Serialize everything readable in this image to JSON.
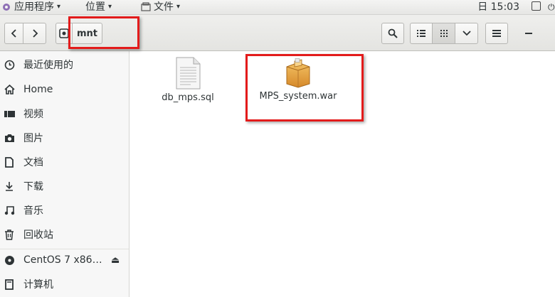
{
  "topbar": {
    "apps_label": "应用程序",
    "places_label": "位置",
    "file_label": "文件",
    "clock": "日 15:03"
  },
  "header": {
    "location": "mnt"
  },
  "sidebar": {
    "items": [
      {
        "label": "最近使用的",
        "icon": "clock-icon"
      },
      {
        "label": "Home",
        "icon": "home-icon"
      },
      {
        "label": "视频",
        "icon": "video-icon"
      },
      {
        "label": "图片",
        "icon": "camera-icon"
      },
      {
        "label": "文档",
        "icon": "document-icon"
      },
      {
        "label": "下载",
        "icon": "download-icon"
      },
      {
        "label": "音乐",
        "icon": "music-icon"
      },
      {
        "label": "回收站",
        "icon": "trash-icon"
      },
      {
        "label": "CentOS 7 x86…",
        "icon": "disc-icon"
      },
      {
        "label": "计算机",
        "icon": "computer-icon"
      }
    ]
  },
  "files": [
    {
      "name": "db_mps.sql",
      "icon": "text-file-icon"
    },
    {
      "name": "MPS_system.war",
      "icon": "archive-package-icon"
    }
  ],
  "colors": {
    "annotation": "#e31b1b",
    "package": "#e8a33a"
  }
}
